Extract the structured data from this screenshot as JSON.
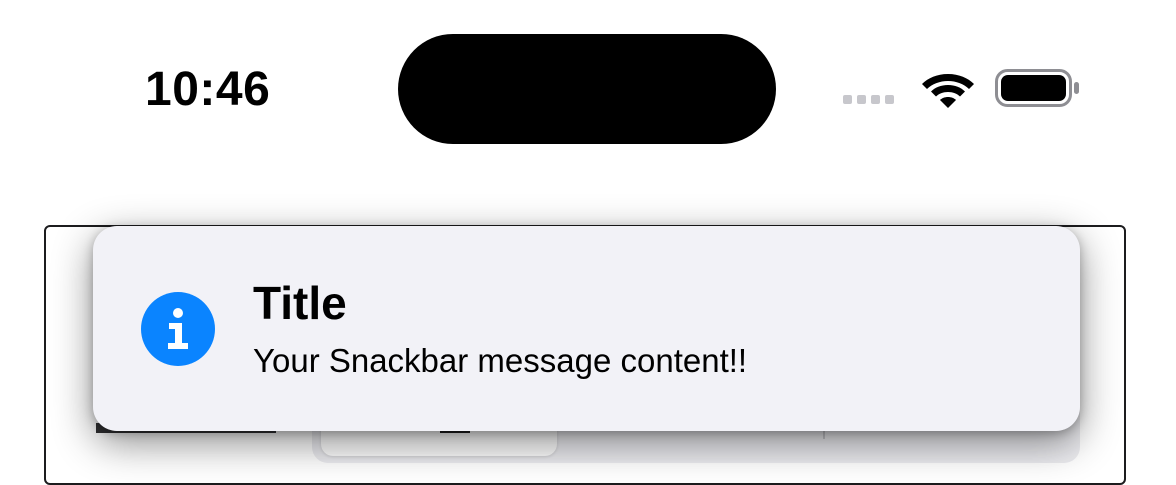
{
  "status_bar": {
    "time": "10:46",
    "icons": [
      "cellular-signal-icon",
      "wifi-icon",
      "battery-icon"
    ]
  },
  "snackbar": {
    "icon": "info-icon",
    "title": "Title",
    "message": "Your Snackbar message content!!",
    "colors": {
      "background": "#f2f2f7",
      "icon_background": "#0a84ff"
    }
  }
}
